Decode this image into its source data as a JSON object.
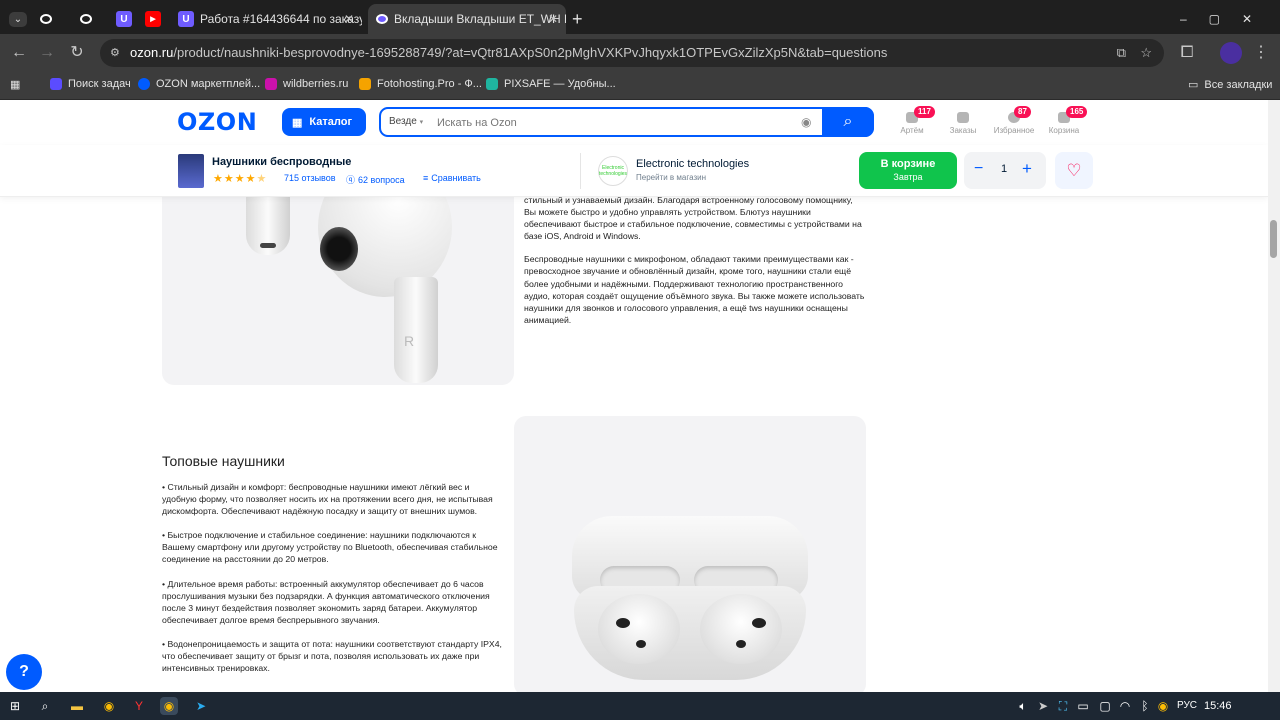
{
  "browser": {
    "tabs": [
      {
        "title": "",
        "icon": "ozon-icon"
      },
      {
        "title": "",
        "icon": "ozon-icon"
      },
      {
        "title": "",
        "icon": "u-icon"
      },
      {
        "title": "",
        "icon": "youtube-icon"
      },
      {
        "title": "Работа #164436644 по заказу",
        "icon": "u-icon"
      },
      {
        "title": "Вкладыши Вкладыши ET_WH Е",
        "icon": "ozon-icon",
        "active": true
      }
    ],
    "new_tab": "+",
    "url_domain": "ozon.ru",
    "url_path": "/product/naushniki-besprovodnye-1695288749/?at=vQtr81AXpS0n2pMghVXKPvJhqyxk1OTPEvGxZilzXp5N&tab=questions",
    "bookmarks": [
      {
        "label": "Поиск задач",
        "color": "#5b4cff"
      },
      {
        "label": "OZON маркетплей...",
        "color": "#005bff"
      },
      {
        "label": "wildberries.ru",
        "color": "#cb11ab"
      },
      {
        "label": "Fotohosting.Pro - Ф...",
        "color": "#f5a300"
      },
      {
        "label": "PIXSAFE — Удобны...",
        "color": "#1fb5a0"
      }
    ],
    "all_bookmarks": "Все закладки"
  },
  "header": {
    "logo": "OZON",
    "catalog": "Каталог",
    "search_scope": "Везде",
    "search_placeholder": "Искать на Ozon",
    "icons": [
      {
        "label": "Артём",
        "badge": "117"
      },
      {
        "label": "Заказы",
        "badge": ""
      },
      {
        "label": "Избранное",
        "badge": "87"
      },
      {
        "label": "Корзина",
        "badge": "165"
      }
    ]
  },
  "product": {
    "title": "Наушники беспроводные",
    "rating": 4.5,
    "reviews": "715 отзывов",
    "questions": "62 вопроса",
    "compare": "Сравнивать",
    "store_name": "Electronic technologies",
    "store_logo_text": "Electronic technologies",
    "store_link": "Перейти в магазин",
    "in_cart": "В корзине",
    "delivery": "Завтра",
    "quantity": "1"
  },
  "content": {
    "para1": "стильный и узнаваемый дизайн. Благодаря встроенному голосовому помощнику, Вы можете быстро и удобно управлять устройством. Блютуз наушники обеспечивают быстрое и стабильное подключение, совместимы с устройствами на базе iOS, Android и Windows.",
    "para2": "Беспроводные наушники с микрофоном, обладают такими преимуществами как - превосходное звучание и обновлённый дизайн, кроме того, наушники стали ещё более удобными и надёжными. Поддерживают технологию пространственного аудио, которая создаёт ощущение объёмного звука. Вы также можете использовать наушники для звонков и голосового управления, а ещё tws наушники оснащены анимацией.",
    "heading": "Топовые наушники",
    "bullets": [
      "• Стильный дизайн и комфорт: беспроводные наушники имеют лёгкий вес и удобную форму, что позволяет носить их на протяжении всего дня, не испытывая дискомфорта. Обеспечивают надёжную посадку и защиту от внешних шумов.",
      "• Быстрое подключение и стабильное соединение: наушники подключаются к Вашему смартфону или другому устройству по Bluetooth, обеспечивая стабильное соединение на расстоянии до 20 метров.",
      "• Длительное время работы: встроенный аккумулятор обеспечивает до 6 часов прослушивания музыки без подзарядки. А функция автоматического отключения после 3 минут бездействия позволяет экономить заряд батареи. Аккумулятор обеспечивает долгое время беспрерывного звучания.",
      "• Водонепроницаемость и защита от пота: наушники соответствуют стандарту IPX4, что обеспечивает защиту от брызг и пота, позволяя использовать их даже при интенсивных тренировках."
    ],
    "bud_letter": "R"
  },
  "taskbar": {
    "lang": "РУС",
    "time": "15:46"
  }
}
